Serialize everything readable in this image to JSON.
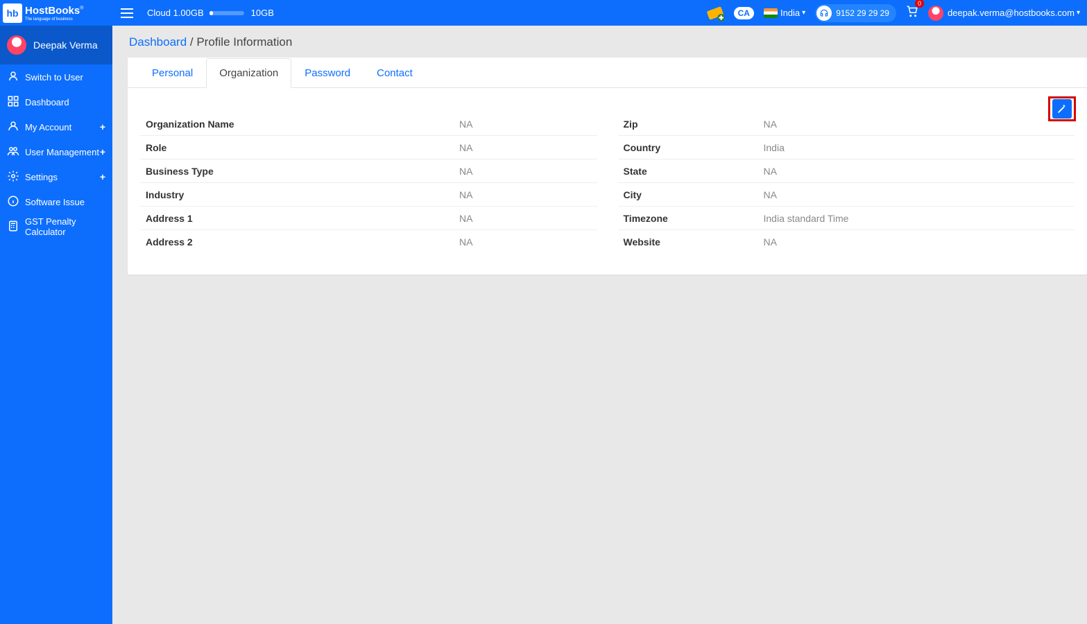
{
  "brand": {
    "short": "hb",
    "name": "HostBooks",
    "tagline": "The language of business",
    "reg": "®"
  },
  "header": {
    "cloud_used": "Cloud 1.00GB",
    "cloud_total": "10GB",
    "ca": "CA",
    "country": "India",
    "phone": "9152 29 29 29",
    "cart_count": "0",
    "user_email": "deepak.verma@hostbooks.com"
  },
  "sidebar": {
    "user": "Deepak Verma",
    "items": [
      {
        "label": "Switch to User",
        "icon": "user",
        "expand": false
      },
      {
        "label": "Dashboard",
        "icon": "dashboard",
        "expand": false
      },
      {
        "label": "My Account",
        "icon": "account",
        "expand": true
      },
      {
        "label": "User Management",
        "icon": "users",
        "expand": true
      },
      {
        "label": "Settings",
        "icon": "gear",
        "expand": true
      },
      {
        "label": "Software Issue",
        "icon": "info",
        "expand": false
      },
      {
        "label": "GST Penalty Calculator",
        "icon": "calc",
        "expand": false
      }
    ]
  },
  "breadcrumb": {
    "root": "Dashboard",
    "sep": " / ",
    "page": "Profile Information"
  },
  "tabs": [
    "Personal",
    "Organization",
    "Password",
    "Contact"
  ],
  "active_tab": "Organization",
  "org_left": [
    {
      "label": "Organization Name",
      "value": "NA"
    },
    {
      "label": "Role",
      "value": "NA"
    },
    {
      "label": "Business Type",
      "value": "NA"
    },
    {
      "label": "Industry",
      "value": "NA"
    },
    {
      "label": "Address 1",
      "value": "NA"
    },
    {
      "label": "Address 2",
      "value": "NA"
    }
  ],
  "org_right": [
    {
      "label": "Zip",
      "value": "NA"
    },
    {
      "label": "Country",
      "value": "India"
    },
    {
      "label": "State",
      "value": "NA"
    },
    {
      "label": "City",
      "value": "NA"
    },
    {
      "label": "Timezone",
      "value": "India standard Time"
    },
    {
      "label": "Website",
      "value": "NA"
    }
  ]
}
